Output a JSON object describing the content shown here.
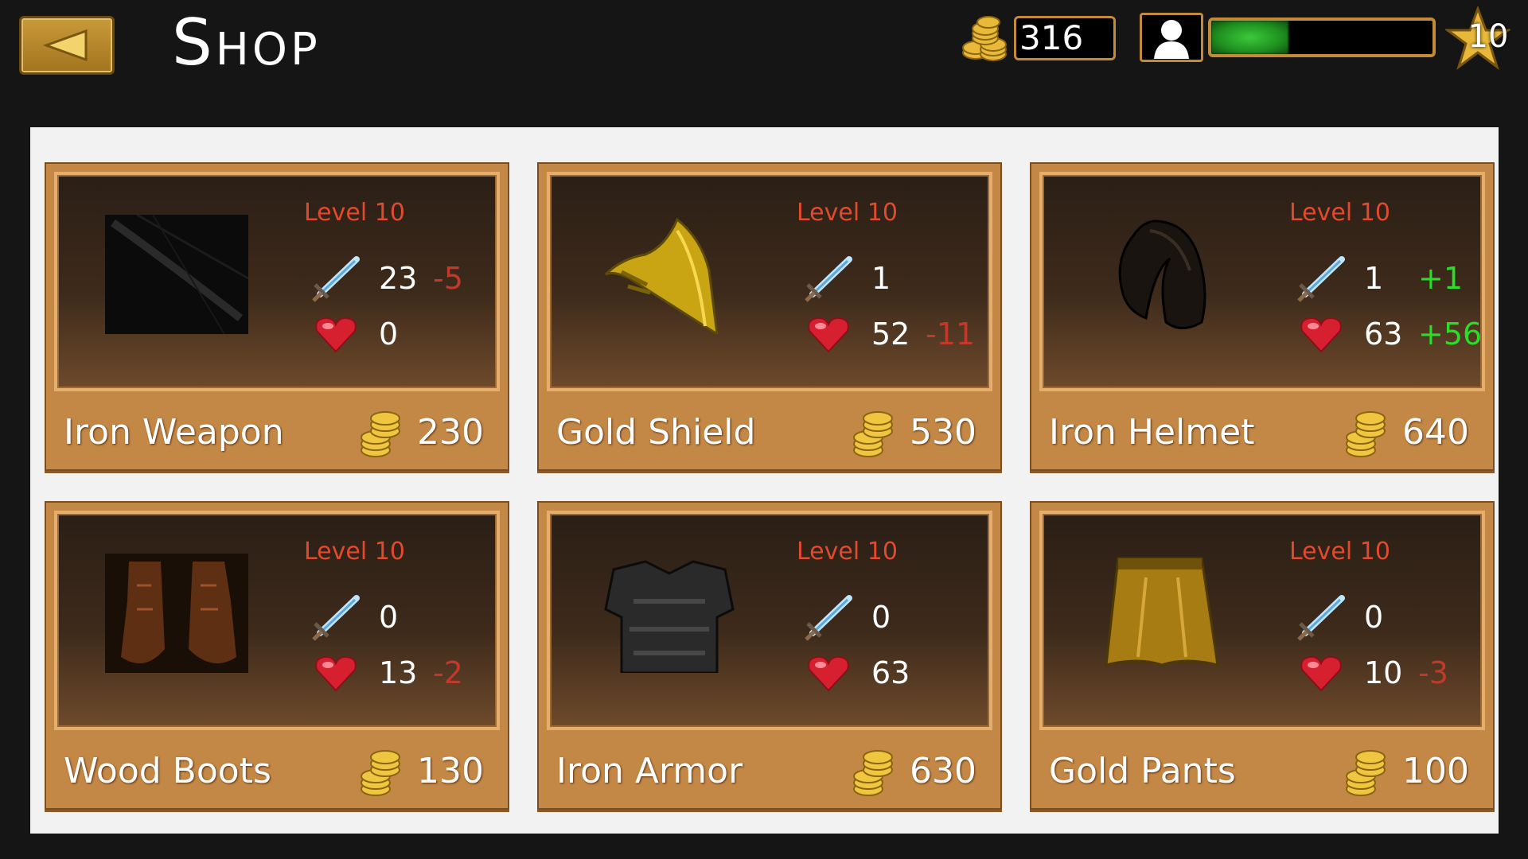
{
  "header": {
    "back_icon": "left-arrow-icon",
    "title": "Shop",
    "gold": "316",
    "xp_fraction": 0.35,
    "player_level": "10"
  },
  "items": [
    {
      "name": "Iron Weapon",
      "price": "230",
      "level": "Level 10",
      "attack": "23",
      "attack_delta": "-5",
      "attack_delta_type": "neg",
      "health": "0",
      "health_delta": "",
      "health_delta_type": "",
      "icon": "sword-item"
    },
    {
      "name": "Gold Shield",
      "price": "530",
      "level": "Level 10",
      "attack": "1",
      "attack_delta": "",
      "attack_delta_type": "",
      "health": "52",
      "health_delta": "-11",
      "health_delta_type": "neg",
      "icon": "shield-item"
    },
    {
      "name": "Iron Helmet",
      "price": "640",
      "level": "Level 10",
      "attack": "1",
      "attack_delta": "+1",
      "attack_delta_type": "pos",
      "health": "63",
      "health_delta": "+56",
      "health_delta_type": "pos",
      "icon": "helmet-item"
    },
    {
      "name": "Wood Boots",
      "price": "130",
      "level": "Level 10",
      "attack": "0",
      "attack_delta": "",
      "attack_delta_type": "",
      "health": "13",
      "health_delta": "-2",
      "health_delta_type": "neg",
      "icon": "boots-item"
    },
    {
      "name": "Iron Armor",
      "price": "630",
      "level": "Level 10",
      "attack": "0",
      "attack_delta": "",
      "attack_delta_type": "",
      "health": "63",
      "health_delta": "",
      "health_delta_type": "",
      "icon": "armor-item"
    },
    {
      "name": "Gold Pants",
      "price": "100",
      "level": "Level 10",
      "attack": "0",
      "attack_delta": "",
      "attack_delta_type": "",
      "health": "10",
      "health_delta": "-3",
      "health_delta_type": "neg",
      "icon": "pants-item"
    }
  ],
  "colors": {
    "card": "#c38746",
    "level_text": "#e04a2f",
    "negative": "#c0392b",
    "positive": "#2bdc2b"
  }
}
